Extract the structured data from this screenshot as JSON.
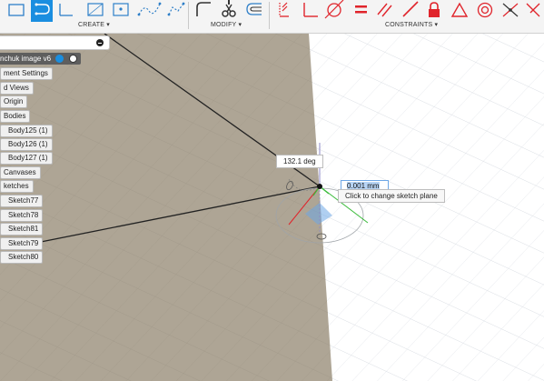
{
  "toolbar": {
    "groups": [
      {
        "label": "CREATE ▾"
      },
      {
        "label": "MODIFY ▾"
      },
      {
        "label": "CONSTRAINTS ▾"
      }
    ],
    "accent": "#1a8ee0",
    "constraint_red": "#e0242b"
  },
  "browser": {
    "root_label": "nchuk image v6",
    "items": [
      "ment Settings",
      "d Views",
      "Origin",
      "Bodies",
      "Body125 (1)",
      "Body126 (1)",
      "Body127 (1)",
      "Canvases",
      "ketches",
      "Sketch77",
      "Sketch78",
      "Sketch81",
      "Sketch79",
      "Sketch80"
    ]
  },
  "canvas": {
    "angle_label": "132.1 deg",
    "dimension_value": "0.001 mm",
    "hint": "Click to change sketch plane",
    "sketch_plane_color": "#aea595",
    "grid_color": "#d9dde3"
  }
}
